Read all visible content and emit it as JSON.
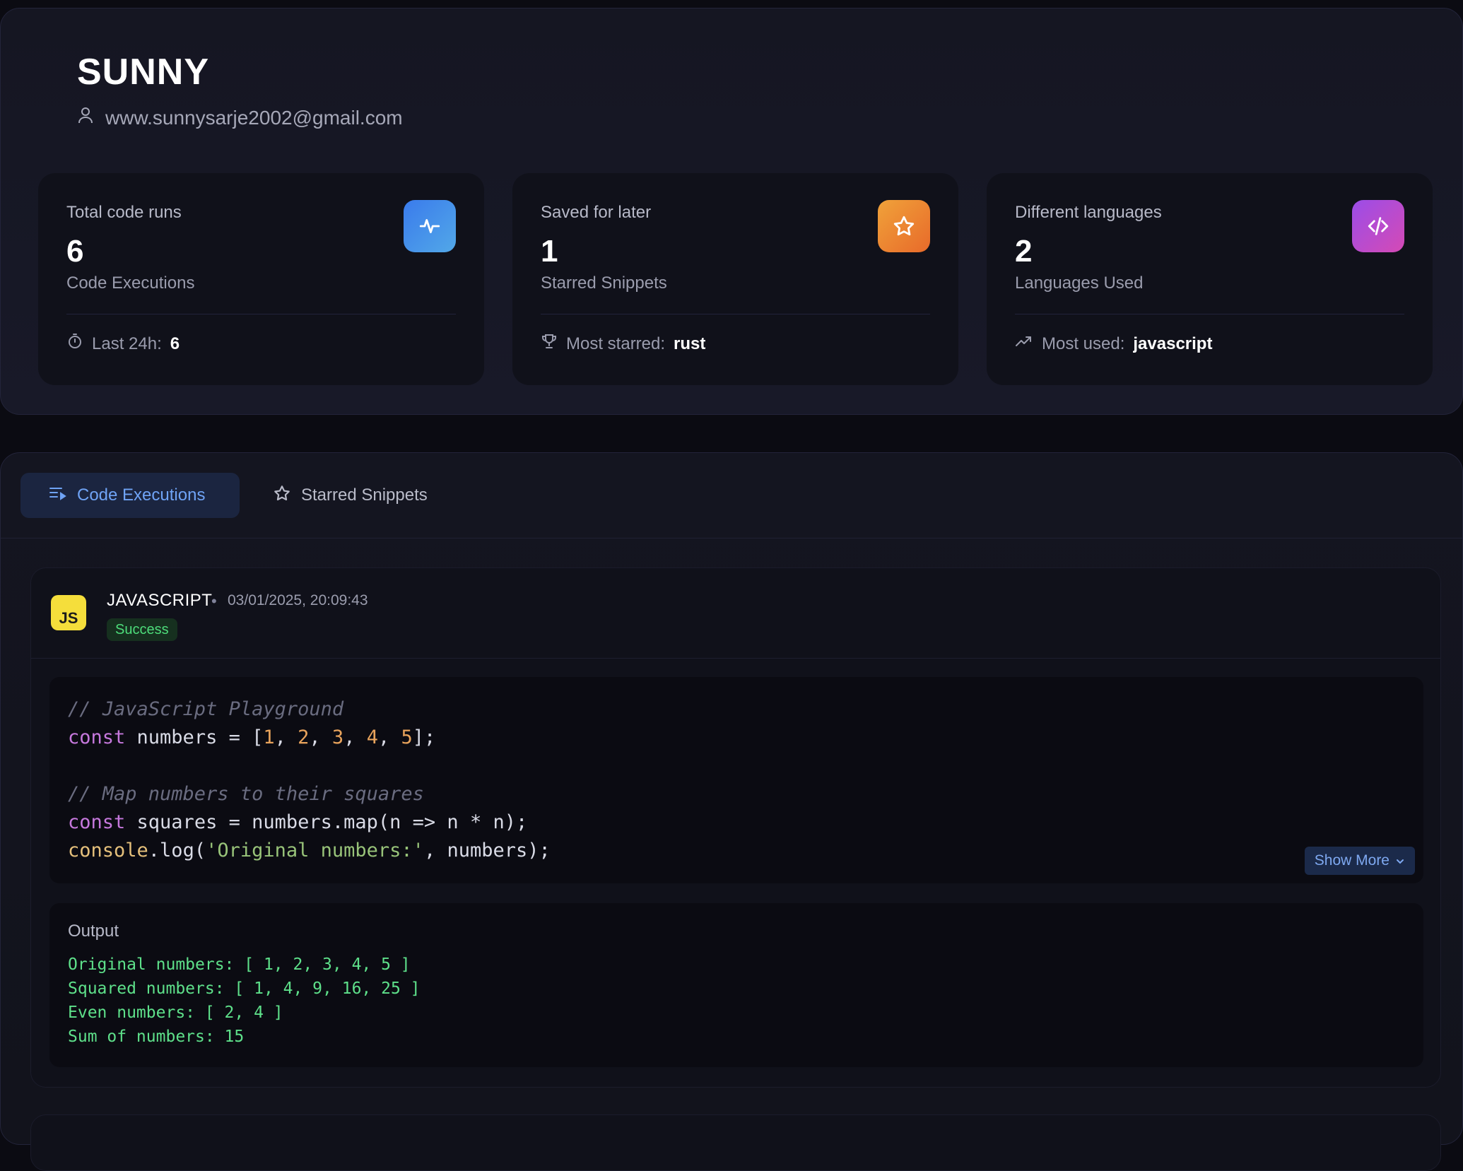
{
  "profile": {
    "name": "SUNNY",
    "email": "www.sunnysarje2002@gmail.com",
    "stats": [
      {
        "label": "Total code runs",
        "value": "6",
        "sublabel": "Code Executions",
        "footer_label": "Last 24h:",
        "footer_value": "6",
        "icon": "activity-icon",
        "footer_icon": "timer-icon",
        "colors": [
          "#3a7bec",
          "#52a8e8"
        ]
      },
      {
        "label": "Saved for later",
        "value": "1",
        "sublabel": "Starred Snippets",
        "footer_label": "Most starred:",
        "footer_value": "rust",
        "icon": "star-icon",
        "footer_icon": "trophy-icon",
        "colors": [
          "#f0a23a",
          "#e86a2a"
        ]
      },
      {
        "label": "Different languages",
        "value": "2",
        "sublabel": "Languages Used",
        "footer_label": "Most used:",
        "footer_value": "javascript",
        "icon": "code-icon",
        "footer_icon": "trending-up-icon",
        "colors": [
          "#9b4de8",
          "#d54ab5"
        ]
      }
    ]
  },
  "tabs": {
    "active_label": "Code Executions",
    "inactive_label": "Starred Snippets"
  },
  "execution": {
    "language": "JAVASCRIPT",
    "badge": "JS",
    "timestamp": "03/01/2025, 20:09:43",
    "status": "Success",
    "code": {
      "line1": "// JavaScript Playground",
      "line2_kw": "const",
      "line2_a": " numbers = [",
      "n1": "1",
      "n2": "2",
      "n3": "3",
      "n4": "4",
      "n5": "5",
      "comma": ", ",
      "line2_end": "];",
      "line4": "// Map numbers to their squares",
      "line5_kw": "const",
      "line5_rest": " squares = numbers.map(n => n * n);",
      "line6_fn": "console",
      "line6_a": ".log(",
      "line6_str": "'Original numbers:'",
      "line6_end": ", numbers);"
    },
    "show_more_label": "Show More",
    "output_title": "Output",
    "output_lines": [
      "Original numbers: [ 1, 2, 3, 4, 5 ]",
      "Squared numbers: [ 1, 4, 9, 16, 25 ]",
      "Even numbers: [ 2, 4 ]",
      "Sum of numbers: 15"
    ]
  }
}
